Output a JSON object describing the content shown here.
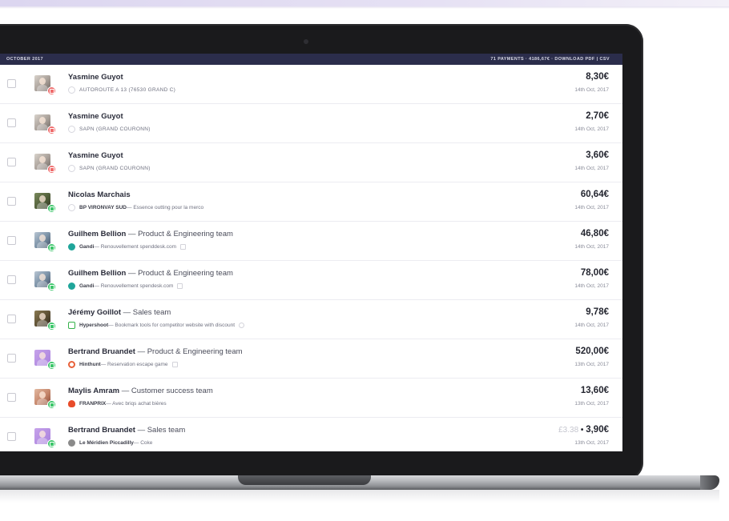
{
  "header": {
    "period": "OCTOBER 2017",
    "summary": "71 PAYMENTS · 4186,67€ · DOWNLOAD PDF | CSV"
  },
  "colors": {
    "header_bg": "#2b2d4b",
    "status_red": "#ef6b6b",
    "status_green": "#3cc66a",
    "gandi": "#1fa59a",
    "hypershoot": "#35b24a",
    "hinthunt": "#e8613a",
    "franprix": "#e84c2a"
  },
  "payments": [
    {
      "name": "Yasmine Guyot",
      "team_sep": "",
      "team": "",
      "status": "red",
      "avatar": "yasmine",
      "merchant_icon": "generic-merchant-icon",
      "merchant": "",
      "sub_text": "AUTOROUTE A 13 (76530 GRAND C)",
      "receipt": false,
      "sync": false,
      "orig_amount": "",
      "orig_sep": "",
      "amount": "8,30€",
      "date": "14th Oct, 2017"
    },
    {
      "name": "Yasmine Guyot",
      "team_sep": "",
      "team": "",
      "status": "red",
      "avatar": "yasmine",
      "merchant_icon": "generic-merchant-icon",
      "merchant": "",
      "sub_text": "SAPN (GRAND COURONN)",
      "receipt": false,
      "sync": false,
      "orig_amount": "",
      "orig_sep": "",
      "amount": "2,70€",
      "date": "14th Oct, 2017"
    },
    {
      "name": "Yasmine Guyot",
      "team_sep": "",
      "team": "",
      "status": "red",
      "avatar": "yasmine",
      "merchant_icon": "generic-merchant-icon",
      "merchant": "",
      "sub_text": "SAPN (GRAND COURONN)",
      "receipt": false,
      "sync": false,
      "orig_amount": "",
      "orig_sep": "",
      "amount": "3,60€",
      "date": "14th Oct, 2017"
    },
    {
      "name": "Nicolas Marchais",
      "team_sep": "",
      "team": "",
      "status": "green",
      "avatar": "nicolas",
      "merchant_icon": "generic-merchant-icon",
      "merchant": "BP VIRONVAY SUD",
      "sub_text": " — Essence outting pour la merco",
      "receipt": false,
      "sync": false,
      "orig_amount": "",
      "orig_sep": "",
      "amount": "60,64€",
      "date": "14th Oct, 2017"
    },
    {
      "name": "Guilhem Bellion",
      "team_sep": " — ",
      "team": "Product & Engineering team",
      "status": "green",
      "avatar": "guilhem",
      "merchant_icon": "gandi-icon",
      "merchant": "Gandi",
      "sub_text": " — Renouvellement spenddesk.com",
      "receipt": true,
      "sync": false,
      "orig_amount": "",
      "orig_sep": "",
      "amount": "46,80€",
      "date": "14th Oct, 2017"
    },
    {
      "name": "Guilhem Bellion",
      "team_sep": " — ",
      "team": "Product & Engineering team",
      "status": "green",
      "avatar": "guilhem",
      "merchant_icon": "gandi-icon",
      "merchant": "Gandi",
      "sub_text": " — Renouvellement spendesk.com",
      "receipt": true,
      "sync": false,
      "orig_amount": "",
      "orig_sep": "",
      "amount": "78,00€",
      "date": "14th Oct, 2017"
    },
    {
      "name": "Jérémy Goillot",
      "team_sep": " — ",
      "team": "Sales team",
      "status": "green",
      "avatar": "jeremy",
      "merchant_icon": "hypershoot-icon",
      "merchant": "Hypershoot",
      "sub_text": " — Bookmark tools for competitor website with discount",
      "receipt": false,
      "sync": true,
      "orig_amount": "",
      "orig_sep": "",
      "amount": "9,78€",
      "date": "14th Oct, 2017"
    },
    {
      "name": "Bertrand Bruandet",
      "team_sep": " — ",
      "team": "Product & Engineering team",
      "status": "green",
      "avatar": "bertrand",
      "merchant_icon": "hinthunt-icon",
      "merchant": "Hinthunt",
      "sub_text": " — Reservation escape game",
      "receipt": true,
      "sync": false,
      "orig_amount": "",
      "orig_sep": "",
      "amount": "520,00€",
      "date": "13th Oct, 2017"
    },
    {
      "name": "Maylis Amram",
      "team_sep": " — ",
      "team": "Customer success team",
      "status": "green",
      "avatar": "maylis",
      "merchant_icon": "franprix-icon",
      "merchant": "FRANPRIX",
      "sub_text": " — Avec briqs achat bières",
      "receipt": false,
      "sync": false,
      "orig_amount": "",
      "orig_sep": "",
      "amount": "13,60€",
      "date": "13th Oct, 2017"
    },
    {
      "name": "Bertrand Bruandet",
      "team_sep": " — ",
      "team": "Sales team",
      "status": "green",
      "avatar": "bertrand",
      "merchant_icon": "meridien-icon",
      "merchant": "Le Méridien Piccadilly",
      "sub_text": " — Coke",
      "receipt": false,
      "sync": false,
      "orig_amount": "£3.38",
      "orig_sep": " • ",
      "amount": "3,90€",
      "date": "13th Oct, 2017"
    }
  ]
}
